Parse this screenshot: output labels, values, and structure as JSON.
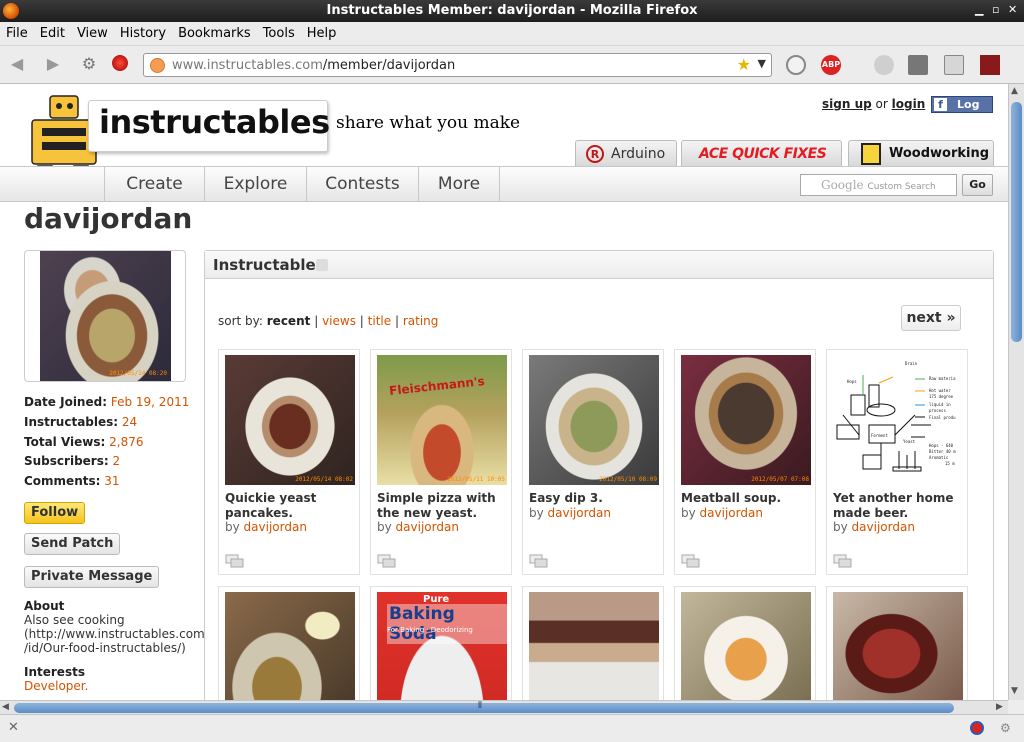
{
  "window": {
    "title": "Instructables Member: davijordan - Mozilla Firefox"
  },
  "menu": [
    "File",
    "Edit",
    "View",
    "History",
    "Bookmarks",
    "Tools",
    "Help"
  ],
  "address": {
    "host": "www.instructables.com",
    "path": "/member/davijordan"
  },
  "site": {
    "logo": "instructables",
    "tagline": "share what you make",
    "signup": "sign up",
    "or1": "or",
    "login": "login",
    "or2": "or",
    "fb_login": "Log In",
    "channels": [
      "Arduino",
      "ACE QUICK FIXES",
      "Woodworking"
    ],
    "nav": [
      "Create",
      "Explore",
      "Contests",
      "More"
    ],
    "search_placeholder": "Custom Search",
    "search_brand": "Google",
    "go": "Go"
  },
  "member": {
    "username": "davijordan",
    "avatar_stamp": "2012/05/14 08:20",
    "stats": [
      {
        "label": "Date Joined:",
        "value": "Feb 19, 2011"
      },
      {
        "label": "Instructables:",
        "value": "24"
      },
      {
        "label": "Total Views:",
        "value": "2,876"
      },
      {
        "label": "Subscribers:",
        "value": "2"
      },
      {
        "label": "Comments:",
        "value": "31"
      }
    ],
    "follow": "Follow",
    "send_patch": "Send Patch",
    "private_message": "Private Message",
    "about_heading": "About",
    "about_lines": [
      "Also see cooking",
      "(http://www.instructables.com",
      "/id/Our-food-instructables/)"
    ],
    "interests_heading": "Interests",
    "interests": "Developer."
  },
  "instructables": {
    "heading": "Instructables",
    "sort_label": "sort by:",
    "sort_active": "recent",
    "sort_options": [
      "views",
      "title",
      "rating"
    ],
    "sep": "|",
    "next": "next »",
    "by": "by",
    "items": [
      {
        "title": "Quickie yeast pancakes.",
        "author": "davijordan",
        "stamp": "2012/05/14 08:02"
      },
      {
        "title": "Simple pizza with the new yeast.",
        "author": "davijordan",
        "stamp": "2012/05/11 10:05"
      },
      {
        "title": "Easy dip 3.",
        "author": "davijordan",
        "stamp": "2012/05/10 08:09"
      },
      {
        "title": "Meatball soup.",
        "author": "davijordan",
        "stamp": "2012/05/07 07:08"
      },
      {
        "title": "Yet another home made beer.",
        "author": "davijordan",
        "stamp": ""
      }
    ],
    "second_row": [
      {
        "label": ""
      },
      {
        "label": "Pure",
        "label2": "Baking Soda",
        "label3": "For Baking · Deodorizing"
      },
      {
        "label": ""
      },
      {
        "label": ""
      },
      {
        "label": ""
      }
    ],
    "beer_labels": [
      "Drain",
      "Raw materia",
      "Hot water",
      "175 degree",
      "liquid in",
      "process",
      "Final produ",
      "Hops",
      "Ferment",
      "Yeast",
      "Hops - 640",
      "Bitter 40 m",
      "Aromatic",
      "15 m"
    ]
  },
  "colors": {
    "accent": "#d35400",
    "follow": "#f5c31b",
    "facebook": "#5872a7"
  }
}
